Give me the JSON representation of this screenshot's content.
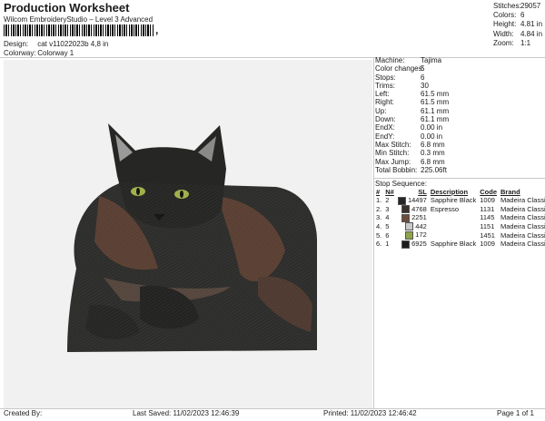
{
  "header": {
    "title": "Production Worksheet",
    "subtitle": "Wilcom EmbroideryStudio – Level 3 Advanced",
    "barcode_tail": ","
  },
  "meta": {
    "design_label": "Design:",
    "design_value": "cat v11022023b 4,8 in",
    "colorway_label": "Colorway:",
    "colorway_value": "Colorway 1"
  },
  "stats": [
    {
      "label": "Stitches:",
      "value": "29057"
    },
    {
      "label": "Colors:",
      "value": "6"
    },
    {
      "label": "Height:",
      "value": "4.81 in"
    },
    {
      "label": "Width:",
      "value": "4.84 in"
    },
    {
      "label": "Zoom:",
      "value": "1:1"
    }
  ],
  "machine_info": [
    {
      "label": "Machine:",
      "value": "Tajima"
    },
    {
      "label": "Color changes:",
      "value": "5"
    },
    {
      "label": "Stops:",
      "value": "6"
    },
    {
      "label": "Trims:",
      "value": "30"
    },
    {
      "label": "Left:",
      "value": "61.5 mm"
    },
    {
      "label": "Right:",
      "value": "61.5 mm"
    },
    {
      "label": "Up:",
      "value": "61.1 mm"
    },
    {
      "label": "Down:",
      "value": "61.1 mm"
    },
    {
      "label": "EndX:",
      "value": "0.00 in"
    },
    {
      "label": "EndY:",
      "value": "0.00 in"
    },
    {
      "label": "Max Stitch:",
      "value": "6.8 mm"
    },
    {
      "label": "Min Stitch:",
      "value": "0.3 mm"
    },
    {
      "label": "Max Jump:",
      "value": "6.8 mm"
    },
    {
      "label": "Total Bobbin:",
      "value": "225.06ft"
    }
  ],
  "stop_sequence": {
    "title": "Stop Sequence:",
    "headers": {
      "num": "#",
      "n": "N#",
      "sl": "SL",
      "desc": "Description",
      "code": "Code",
      "brand": "Brand"
    },
    "rows": [
      {
        "num": "1.",
        "n": "2",
        "color": "#262626",
        "sl": "14497",
        "desc": "Sapphire Black",
        "code": "1009",
        "brand": "Madeira Classic 40"
      },
      {
        "num": "2.",
        "n": "3",
        "color": "#3a312c",
        "sl": "4768",
        "desc": "Espresso",
        "code": "1131",
        "brand": "Madeira Classic 40"
      },
      {
        "num": "3.",
        "n": "4",
        "color": "#6e4d3c",
        "sl": "2251",
        "desc": "",
        "code": "1145",
        "brand": "Madeira Classic 40"
      },
      {
        "num": "4.",
        "n": "5",
        "color": "#c9c9c9",
        "sl": "442",
        "desc": "",
        "code": "1151",
        "brand": "Madeira Classic 40"
      },
      {
        "num": "5.",
        "n": "6",
        "color": "#8fa34a",
        "sl": "172",
        "desc": "",
        "code": "1451",
        "brand": "Madeira Classic 40"
      },
      {
        "num": "6.",
        "n": "1",
        "color": "#1c1c1c",
        "sl": "6925",
        "desc": "Sapphire Black",
        "code": "1009",
        "brand": "Madeira Classic 40"
      }
    ]
  },
  "footer": {
    "created_by": "Created By:",
    "last_saved": "Last Saved: 11/02/2023 12:46:39",
    "printed": "Printed: 11/02/2023 12:46:42",
    "page": "Page 1 of 1"
  }
}
